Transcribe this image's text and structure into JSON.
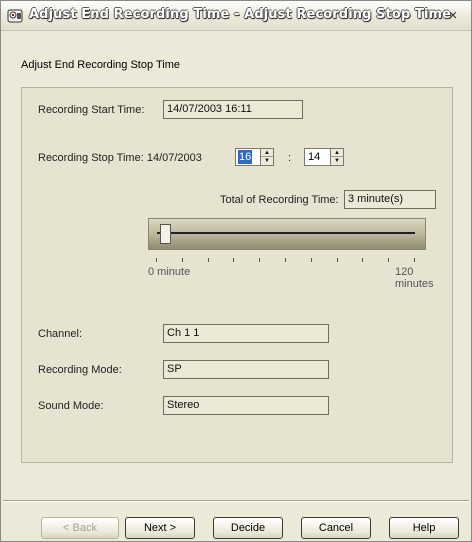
{
  "window": {
    "title": "Adjust End Recording Time - Adjust Recording Stop Time",
    "close_glyph": "×",
    "app_icon": "recorder-app-icon"
  },
  "page": {
    "heading": "Adjust End Recording Stop Time"
  },
  "recording": {
    "start_label": "Recording Start Time:",
    "start_value": "14/07/2003 16:11",
    "stop_label": "Recording Stop Time: 14/07/2003",
    "stop_hour": "16",
    "time_separator": ":",
    "stop_minute": "14",
    "total_label": "Total of Recording Time:",
    "total_value": "3 minute(s)"
  },
  "slider": {
    "min_label": "0 minute",
    "max_label": "120 minutes",
    "min": 0,
    "max": 120,
    "value": 3
  },
  "details": {
    "channel_label": "Channel:",
    "channel_value": "Ch 1 1",
    "mode_label": "Recording Mode:",
    "mode_value": "SP",
    "sound_label": "Sound Mode:",
    "sound_value": "Stereo"
  },
  "buttons": {
    "back": "< Back",
    "next": "Next >",
    "decide": "Decide",
    "cancel": "Cancel",
    "help": "Help"
  }
}
